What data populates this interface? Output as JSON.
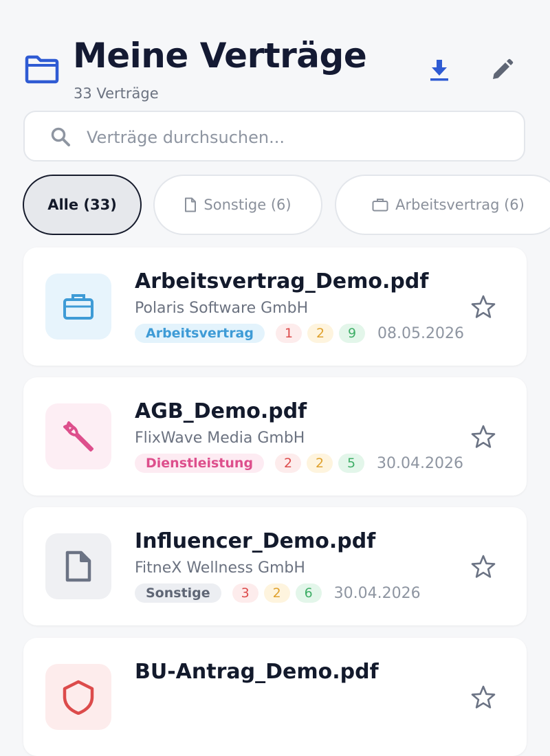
{
  "header": {
    "title": "Meine Verträge",
    "subtitle": "33 Verträge",
    "icons": {
      "folder": "folder-icon",
      "download": "download-icon",
      "edit": "pencil-icon"
    }
  },
  "search": {
    "placeholder": "Verträge durchsuchen...",
    "value": "",
    "icon": "search-icon"
  },
  "filters": [
    {
      "label": "Alle (33)",
      "selected": true
    },
    {
      "label": "Sonstige (6)",
      "icon": "document-icon",
      "selected": false
    },
    {
      "label": "Arbeitsvertrag (6)",
      "icon": "briefcase-icon",
      "selected": false
    }
  ],
  "contracts": [
    {
      "title": "Arbeitsvertrag_Demo.pdf",
      "company": "Polaris Software GmbH",
      "category": "Arbeitsvertrag",
      "counts": [
        "1",
        "2",
        "9"
      ],
      "date": "08.05.2026",
      "icon": "briefcase-icon",
      "colors": {
        "icon_bg": "#e7f4fc",
        "icon": "#3e9bd6",
        "cat_bg": "#e3f3fc",
        "cat_text": "#3e9bd6"
      }
    },
    {
      "title": "AGB_Demo.pdf",
      "company": "FlixWave Media GmbH",
      "category": "Dienstleistung",
      "counts": [
        "2",
        "2",
        "5"
      ],
      "date": "30.04.2026",
      "icon": "wrench-icon",
      "colors": {
        "icon_bg": "#fdeef4",
        "icon": "#dd4f8c",
        "cat_bg": "#fdebf2",
        "cat_text": "#dd4f8c"
      }
    },
    {
      "title": "Influencer_Demo.pdf",
      "company": "FitneX Wellness GmbH",
      "category": "Sonstige",
      "counts": [
        "3",
        "2",
        "6"
      ],
      "date": "30.04.2026",
      "icon": "document-icon",
      "colors": {
        "icon_bg": "#eff0f3",
        "icon": "#6b7384",
        "cat_bg": "#eceef2",
        "cat_text": "#5f6675"
      }
    },
    {
      "title": "BU-Antrag_Demo.pdf",
      "icon": "shield-icon",
      "colors": {
        "icon_bg": "#fdecec",
        "icon": "#dc4b4b"
      }
    }
  ],
  "colors": {
    "accent": "#2f5bd3",
    "text_dark": "#141a33",
    "muted": "#6b7280",
    "background": "#f6f7f9"
  }
}
